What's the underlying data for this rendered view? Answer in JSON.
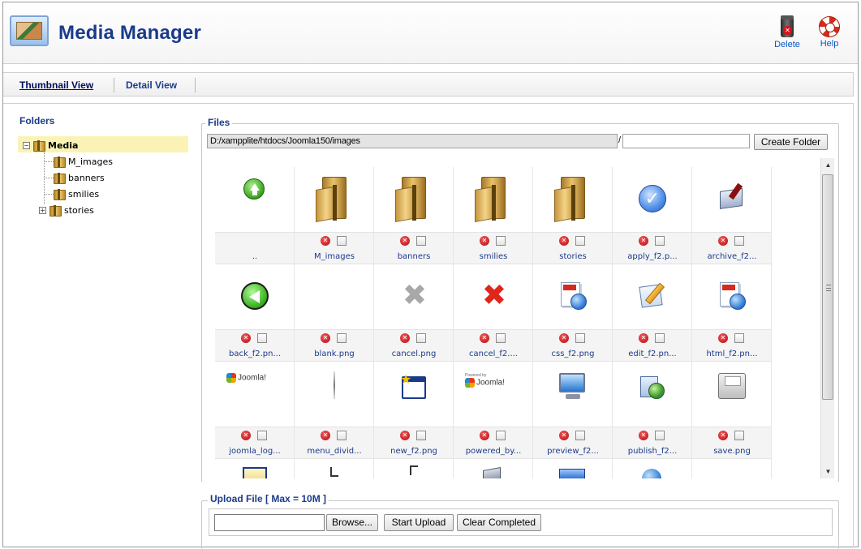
{
  "header": {
    "title": "Media Manager",
    "toolbar": {
      "delete_label": "Delete",
      "help_label": "Help"
    }
  },
  "tabs": [
    {
      "label": "Thumbnail View"
    },
    {
      "label": "Detail View"
    }
  ],
  "folders": {
    "title": "Folders",
    "root": "Media",
    "children": [
      "M_images",
      "banners",
      "smilies",
      "stories"
    ]
  },
  "files": {
    "legend": "Files",
    "path": "D:/xampplite/htdocs/Joomla150/images",
    "path_separator": "/",
    "folder_name_value": "",
    "create_folder_label": "Create Folder",
    "items": [
      {
        "name": "..",
        "icon": "up-arrow-icon",
        "deletable": false
      },
      {
        "name": "M_images",
        "icon": "folder-icon",
        "deletable": true
      },
      {
        "name": "banners",
        "icon": "folder-icon",
        "deletable": true
      },
      {
        "name": "smilies",
        "icon": "folder-icon",
        "deletable": true
      },
      {
        "name": "stories",
        "icon": "folder-icon",
        "deletable": true
      },
      {
        "name": "apply_f2.p...",
        "icon": "checkmark-icon",
        "deletable": true
      },
      {
        "name": "archive_f2...",
        "icon": "archive-icon",
        "deletable": true
      },
      {
        "name": "back_f2.pn...",
        "icon": "back-arrow-icon",
        "deletable": true
      },
      {
        "name": "blank.png",
        "icon": "blank-icon",
        "deletable": true
      },
      {
        "name": "cancel.png",
        "icon": "gray-x-icon",
        "deletable": true
      },
      {
        "name": "cancel_f2....",
        "icon": "red-x-icon",
        "deletable": true
      },
      {
        "name": "css_f2.png",
        "icon": "css-globe-icon",
        "deletable": true
      },
      {
        "name": "edit_f2.pn...",
        "icon": "edit-pencil-icon",
        "deletable": true
      },
      {
        "name": "html_f2.pn...",
        "icon": "html-globe-icon",
        "deletable": true
      },
      {
        "name": "joomla_log...",
        "icon": "joomla-logo-icon",
        "deletable": true
      },
      {
        "name": "menu_divid...",
        "icon": "divider-icon",
        "deletable": true
      },
      {
        "name": "new_f2.png",
        "icon": "new-window-icon",
        "deletable": true
      },
      {
        "name": "powered_by...",
        "icon": "powered-by-joomla-icon",
        "deletable": true
      },
      {
        "name": "preview_f2...",
        "icon": "monitor-icon",
        "deletable": true
      },
      {
        "name": "publish_f2...",
        "icon": "publish-globe-icon",
        "deletable": true
      },
      {
        "name": "save.png",
        "icon": "floppy-disk-icon",
        "deletable": true
      }
    ],
    "joomla_text": "Joomla!",
    "powered_by_text": "Powered by"
  },
  "upload": {
    "legend": "Upload File [ Max = 10M ]",
    "browse_label": "Browse...",
    "start_label": "Start Upload",
    "clear_label": "Clear Completed"
  }
}
